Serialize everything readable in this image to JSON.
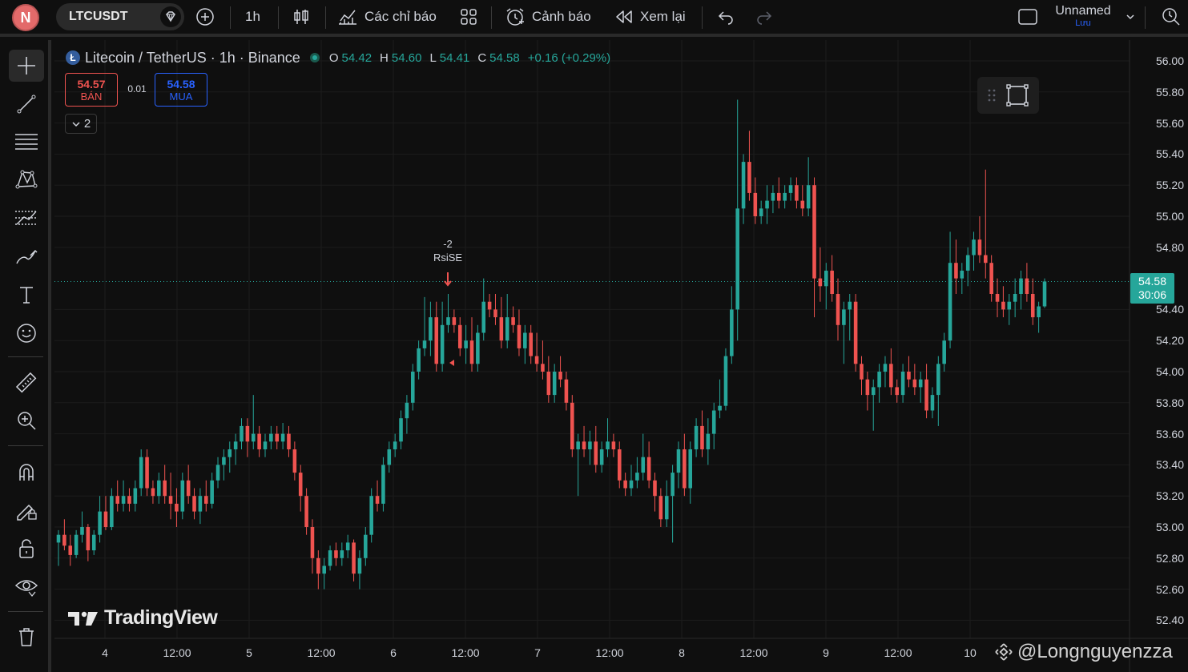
{
  "topbar": {
    "avatar_letter": "N",
    "symbol": "LTCUSDT",
    "interval": "1h",
    "indicators_label": "Các chỉ báo",
    "alerts_label": "Cảnh báo",
    "replay_label": "Xem lại",
    "layout_name": "Unnamed",
    "save_label": "Lưu"
  },
  "legend": {
    "title": "Litecoin / TetherUS · 1h · Binance",
    "coin_letter": "Ł",
    "open_key": "O",
    "open": "54.42",
    "high_key": "H",
    "high": "54.60",
    "low_key": "L",
    "low": "54.41",
    "close_key": "C",
    "close": "54.58",
    "change": "+0.16 (+0.29%)"
  },
  "trade": {
    "sell_price": "54.57",
    "sell_label": "BÁN",
    "spread": "0.01",
    "buy_price": "54.58",
    "buy_label": "MUA",
    "collapse_count": "2"
  },
  "price_tag": {
    "price": "54.58",
    "countdown": "30:06"
  },
  "signal": {
    "value": "-2",
    "label": "RsiSE"
  },
  "branding": {
    "logo_text": "TradingView",
    "watermark": "@Longnguyenzza"
  },
  "colors": {
    "up": "#26a69a",
    "down": "#ef5350",
    "accent": "#2962ff",
    "background": "#0f0f0f"
  },
  "left_tools": [
    "crosshair-icon",
    "trendline-icon",
    "fib-icon",
    "pattern-icon",
    "forecast-icon",
    "brush-icon",
    "text-icon",
    "emoji-icon",
    "ruler-icon",
    "zoom-in-icon",
    "magnet-icon",
    "lock-drawing-icon",
    "lock-icon",
    "eye-icon",
    "trash-icon"
  ],
  "chart_data": {
    "type": "candlestick",
    "interval": "1h",
    "y_ticks": [
      "56.00",
      "55.80",
      "55.60",
      "55.40",
      "55.20",
      "55.00",
      "54.80",
      "54.40",
      "54.20",
      "54.00",
      "53.80",
      "53.60",
      "53.40",
      "53.20",
      "53.00",
      "52.80",
      "52.60",
      "52.40"
    ],
    "x_ticks": [
      "4",
      "12:00",
      "5",
      "12:00",
      "6",
      "12:00",
      "7",
      "12:00",
      "8",
      "12:00",
      "9",
      "12:00",
      "10"
    ],
    "ylim": [
      52.33,
      56.06
    ],
    "last_price": 54.58,
    "candles": [
      [
        52.9,
        52.98,
        52.75,
        52.95
      ],
      [
        52.95,
        53.05,
        52.85,
        52.88
      ],
      [
        52.88,
        52.95,
        52.75,
        52.82
      ],
      [
        52.82,
        52.98,
        52.8,
        52.95
      ],
      [
        52.95,
        53.1,
        52.9,
        53.0
      ],
      [
        53.0,
        53.02,
        52.78,
        52.85
      ],
      [
        52.85,
        52.98,
        52.82,
        52.95
      ],
      [
        52.95,
        53.2,
        52.9,
        53.1
      ],
      [
        53.1,
        53.2,
        52.98,
        53.0
      ],
      [
        53.0,
        53.25,
        52.98,
        53.2
      ],
      [
        53.2,
        53.3,
        53.1,
        53.15
      ],
      [
        53.15,
        53.3,
        53.1,
        53.2
      ],
      [
        53.2,
        53.25,
        53.1,
        53.15
      ],
      [
        53.15,
        53.3,
        53.1,
        53.25
      ],
      [
        53.25,
        53.5,
        53.2,
        53.45
      ],
      [
        53.45,
        53.5,
        53.2,
        53.25
      ],
      [
        53.25,
        53.3,
        53.15,
        53.2
      ],
      [
        53.2,
        53.35,
        53.15,
        53.3
      ],
      [
        53.3,
        53.4,
        53.15,
        53.2
      ],
      [
        53.2,
        53.35,
        53.05,
        53.15
      ],
      [
        53.15,
        53.25,
        53.0,
        53.1
      ],
      [
        53.1,
        53.35,
        53.05,
        53.3
      ],
      [
        53.3,
        53.4,
        53.15,
        53.2
      ],
      [
        53.2,
        53.25,
        53.05,
        53.1
      ],
      [
        53.1,
        53.25,
        53.02,
        53.2
      ],
      [
        53.2,
        53.3,
        53.1,
        53.15
      ],
      [
        53.15,
        53.35,
        53.12,
        53.3
      ],
      [
        53.3,
        53.45,
        53.25,
        53.4
      ],
      [
        53.4,
        53.5,
        53.3,
        53.45
      ],
      [
        53.45,
        53.55,
        53.35,
        53.5
      ],
      [
        53.5,
        53.6,
        53.4,
        53.55
      ],
      [
        53.55,
        53.7,
        53.5,
        53.65
      ],
      [
        53.65,
        53.7,
        53.45,
        53.55
      ],
      [
        53.55,
        53.85,
        53.5,
        53.6
      ],
      [
        53.6,
        53.65,
        53.45,
        53.5
      ],
      [
        53.5,
        53.6,
        53.45,
        53.55
      ],
      [
        53.55,
        53.65,
        53.5,
        53.6
      ],
      [
        53.6,
        53.65,
        53.5,
        53.55
      ],
      [
        53.55,
        53.67,
        53.5,
        53.6
      ],
      [
        53.6,
        53.65,
        53.45,
        53.5
      ],
      [
        53.5,
        53.55,
        53.3,
        53.35
      ],
      [
        53.35,
        53.4,
        53.1,
        53.2
      ],
      [
        53.2,
        53.25,
        52.95,
        53.0
      ],
      [
        53.0,
        53.05,
        52.7,
        52.8
      ],
      [
        52.8,
        52.85,
        52.6,
        52.7
      ],
      [
        52.7,
        52.8,
        52.6,
        52.75
      ],
      [
        52.75,
        52.88,
        52.72,
        52.85
      ],
      [
        52.85,
        52.9,
        52.75,
        52.8
      ],
      [
        52.8,
        52.9,
        52.75,
        52.85
      ],
      [
        52.85,
        52.95,
        52.8,
        52.9
      ],
      [
        52.9,
        52.92,
        52.65,
        52.7
      ],
      [
        52.7,
        52.85,
        52.6,
        52.8
      ],
      [
        52.8,
        53.0,
        52.75,
        52.95
      ],
      [
        52.95,
        53.25,
        52.9,
        53.2
      ],
      [
        53.2,
        53.3,
        53.1,
        53.15
      ],
      [
        53.15,
        53.45,
        53.1,
        53.4
      ],
      [
        53.4,
        53.55,
        53.35,
        53.5
      ],
      [
        53.5,
        53.6,
        53.45,
        53.55
      ],
      [
        53.55,
        53.75,
        53.5,
        53.7
      ],
      [
        53.7,
        53.85,
        53.6,
        53.8
      ],
      [
        53.8,
        54.05,
        53.75,
        54.0
      ],
      [
        54.0,
        54.2,
        53.95,
        54.15
      ],
      [
        54.15,
        54.48,
        54.1,
        54.2
      ],
      [
        54.2,
        54.45,
        54.1,
        54.35
      ],
      [
        54.35,
        54.45,
        54.0,
        54.05
      ],
      [
        54.05,
        54.45,
        54.0,
        54.3
      ],
      [
        54.3,
        54.5,
        54.25,
        54.35
      ],
      [
        54.35,
        54.4,
        54.25,
        54.3
      ],
      [
        54.3,
        54.35,
        54.1,
        54.15
      ],
      [
        54.15,
        54.3,
        54.05,
        54.2
      ],
      [
        54.2,
        54.35,
        54.0,
        54.05
      ],
      [
        54.05,
        54.3,
        54.0,
        54.25
      ],
      [
        54.25,
        54.6,
        54.2,
        54.45
      ],
      [
        54.45,
        54.5,
        54.35,
        54.4
      ],
      [
        54.4,
        54.5,
        54.3,
        54.35
      ],
      [
        54.35,
        54.48,
        54.15,
        54.2
      ],
      [
        54.2,
        54.5,
        54.15,
        54.35
      ],
      [
        54.35,
        54.42,
        54.25,
        54.3
      ],
      [
        54.3,
        54.4,
        54.1,
        54.15
      ],
      [
        54.15,
        54.3,
        54.05,
        54.25
      ],
      [
        54.25,
        54.3,
        54.05,
        54.1
      ],
      [
        54.1,
        54.25,
        54.0,
        54.05
      ],
      [
        54.05,
        54.2,
        53.95,
        54.0
      ],
      [
        54.0,
        54.1,
        53.8,
        53.85
      ],
      [
        53.85,
        54.05,
        53.8,
        54.0
      ],
      [
        54.0,
        54.1,
        53.9,
        53.95
      ],
      [
        53.95,
        54.0,
        53.75,
        53.8
      ],
      [
        53.8,
        53.85,
        53.45,
        53.5
      ],
      [
        53.5,
        53.6,
        53.2,
        53.55
      ],
      [
        53.55,
        53.65,
        53.45,
        53.5
      ],
      [
        53.5,
        53.62,
        53.4,
        53.55
      ],
      [
        53.55,
        53.65,
        53.35,
        53.4
      ],
      [
        53.4,
        53.55,
        53.35,
        53.5
      ],
      [
        53.5,
        53.7,
        53.45,
        53.55
      ],
      [
        53.55,
        53.6,
        53.45,
        53.5
      ],
      [
        53.5,
        53.55,
        53.25,
        53.3
      ],
      [
        53.3,
        53.35,
        53.2,
        53.25
      ],
      [
        53.25,
        53.4,
        53.2,
        53.3
      ],
      [
        53.3,
        53.45,
        53.25,
        53.35
      ],
      [
        53.35,
        53.6,
        53.3,
        53.45
      ],
      [
        53.45,
        53.55,
        53.25,
        53.3
      ],
      [
        53.3,
        53.35,
        53.1,
        53.2
      ],
      [
        53.2,
        53.25,
        53.0,
        53.05
      ],
      [
        53.05,
        53.3,
        53.0,
        53.2
      ],
      [
        53.2,
        53.4,
        52.9,
        53.35
      ],
      [
        53.35,
        53.55,
        53.25,
        53.5
      ],
      [
        53.5,
        53.6,
        53.2,
        53.25
      ],
      [
        53.25,
        53.55,
        53.15,
        53.5
      ],
      [
        53.5,
        53.7,
        53.45,
        53.65
      ],
      [
        53.65,
        53.75,
        53.45,
        53.5
      ],
      [
        53.5,
        53.7,
        53.4,
        53.6
      ],
      [
        53.6,
        53.8,
        53.5,
        53.75
      ],
      [
        53.75,
        53.95,
        53.7,
        53.78
      ],
      [
        53.78,
        54.15,
        53.75,
        54.1
      ],
      [
        54.1,
        54.55,
        54.05,
        54.4
      ],
      [
        54.4,
        55.75,
        54.2,
        55.05
      ],
      [
        55.05,
        55.4,
        54.95,
        55.35
      ],
      [
        55.35,
        55.55,
        55.1,
        55.15
      ],
      [
        55.15,
        55.25,
        54.95,
        55.0
      ],
      [
        55.0,
        55.1,
        54.95,
        55.05
      ],
      [
        55.05,
        55.2,
        54.95,
        55.1
      ],
      [
        55.1,
        55.2,
        55.02,
        55.15
      ],
      [
        55.15,
        55.25,
        55.05,
        55.1
      ],
      [
        55.1,
        55.2,
        55.05,
        55.15
      ],
      [
        55.15,
        55.25,
        55.1,
        55.2
      ],
      [
        55.2,
        55.25,
        55.05,
        55.1
      ],
      [
        55.1,
        55.2,
        55.0,
        55.05
      ],
      [
        55.05,
        55.38,
        55.0,
        55.2
      ],
      [
        55.2,
        55.25,
        54.35,
        54.6
      ],
      [
        54.6,
        54.8,
        54.45,
        54.55
      ],
      [
        54.55,
        54.7,
        54.4,
        54.65
      ],
      [
        54.65,
        54.75,
        54.45,
        54.5
      ],
      [
        54.5,
        54.6,
        54.2,
        54.3
      ],
      [
        54.3,
        54.45,
        54.05,
        54.4
      ],
      [
        54.4,
        54.5,
        54.2,
        54.45
      ],
      [
        54.45,
        54.5,
        54.0,
        54.05
      ],
      [
        54.05,
        54.1,
        53.85,
        53.95
      ],
      [
        53.95,
        54.0,
        53.75,
        53.85
      ],
      [
        53.85,
        53.95,
        53.62,
        53.9
      ],
      [
        53.9,
        54.05,
        53.8,
        54.0
      ],
      [
        54.0,
        54.1,
        53.9,
        54.05
      ],
      [
        54.05,
        54.15,
        53.85,
        53.9
      ],
      [
        53.9,
        53.95,
        53.8,
        53.85
      ],
      [
        53.85,
        54.05,
        53.8,
        54.0
      ],
      [
        54.0,
        54.1,
        53.9,
        53.95
      ],
      [
        53.95,
        54.05,
        53.85,
        53.9
      ],
      [
        53.9,
        54.0,
        53.8,
        53.95
      ],
      [
        53.95,
        54.05,
        53.7,
        53.75
      ],
      [
        53.75,
        53.9,
        53.7,
        53.85
      ],
      [
        53.85,
        54.1,
        53.65,
        54.05
      ],
      [
        54.05,
        54.25,
        54.0,
        54.2
      ],
      [
        54.2,
        54.9,
        54.15,
        54.7
      ],
      [
        54.7,
        54.85,
        54.5,
        54.6
      ],
      [
        54.6,
        54.7,
        54.5,
        54.65
      ],
      [
        54.65,
        54.8,
        54.55,
        54.75
      ],
      [
        54.75,
        54.9,
        54.65,
        54.85
      ],
      [
        54.85,
        55.0,
        54.7,
        54.75
      ],
      [
        54.75,
        55.3,
        54.6,
        54.7
      ],
      [
        54.7,
        54.75,
        54.45,
        54.5
      ],
      [
        54.5,
        54.6,
        54.35,
        54.45
      ],
      [
        54.45,
        54.55,
        54.35,
        54.4
      ],
      [
        54.4,
        54.5,
        54.3,
        54.45
      ],
      [
        54.45,
        54.6,
        54.35,
        54.5
      ],
      [
        54.5,
        54.65,
        54.4,
        54.6
      ],
      [
        54.6,
        54.7,
        54.45,
        54.5
      ],
      [
        54.5,
        54.6,
        54.3,
        54.35
      ],
      [
        54.35,
        54.45,
        54.25,
        54.42
      ],
      [
        54.42,
        54.6,
        54.41,
        54.58
      ]
    ]
  }
}
